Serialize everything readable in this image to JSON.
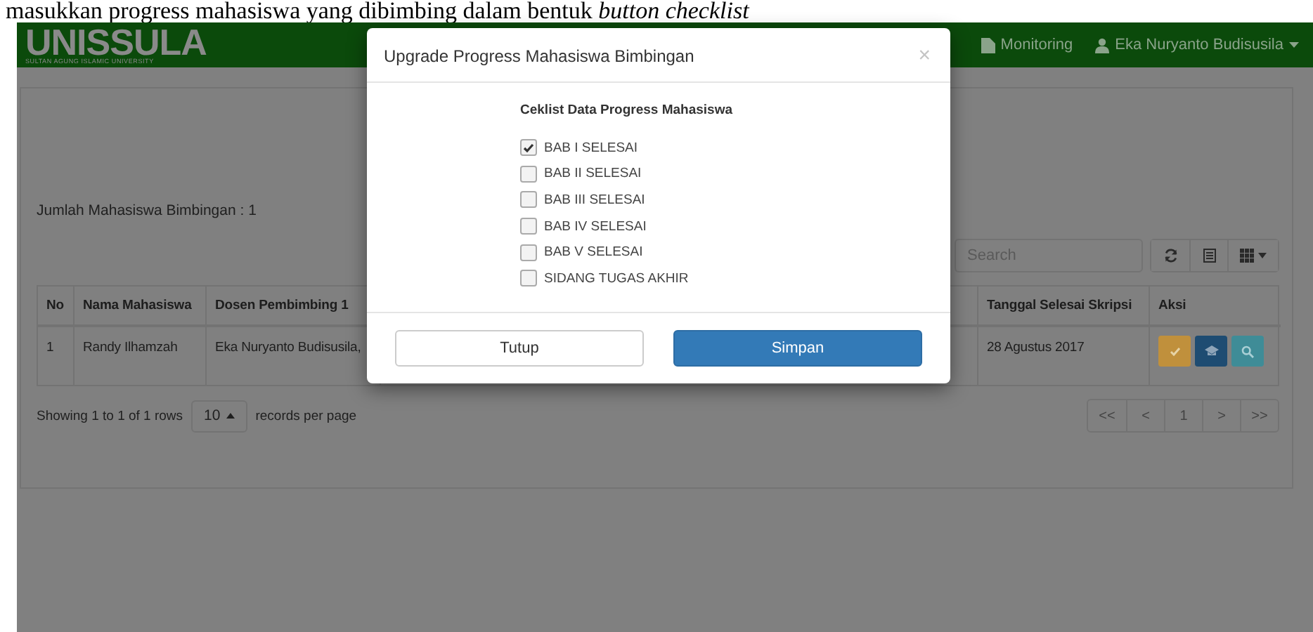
{
  "caption": "masukkan progress mahasiswa yang dibimbing dalam bentuk *button checklist*",
  "navbar": {
    "logo": "UNISSULA",
    "logo_subtitle": "SULTAN AGUNG ISLAMIC UNIVERSITY",
    "items": [
      {
        "label": "Monitoring",
        "kind": "file"
      },
      {
        "label": "Eka Nuryanto Budisusila",
        "kind": "user"
      }
    ]
  },
  "summary": "Jumlah Mahasiswa Bimbingan : 1",
  "search": {
    "placeholder": "Search"
  },
  "table": {
    "columns": [
      "No",
      "Nama Mahasiswa",
      "Dosen Pembimbing 1",
      "Tanggal Selesai Skripsi",
      "Aksi"
    ],
    "rows": [
      {
        "cells": [
          "1",
          "Randy Ilhamzah",
          "Eka Nuryanto Budisusila,",
          "28 Agustus 2017"
        ]
      }
    ]
  },
  "pagination": {
    "info": "Showing 1 to 1 of 1 rows",
    "page_size": "10",
    "suffix": "records per page",
    "pages": [
      "<<",
      "<",
      "1",
      ">",
      ">>"
    ]
  },
  "modal": {
    "title": "Upgrade Progress Mahasiswa Bimbingan",
    "close": "×",
    "heading": "Ceklist Data Progress Mahasiswa",
    "items": [
      {
        "label": "BAB I SELESAI",
        "checked": true
      },
      {
        "label": "BAB II SELESAI",
        "checked": false
      },
      {
        "label": "BAB III SELESAI",
        "checked": false
      },
      {
        "label": "BAB IV SELESAI",
        "checked": false
      },
      {
        "label": "BAB V SELESAI",
        "checked": false
      },
      {
        "label": "SIDANG TUGAS AKHIR",
        "checked": false
      }
    ],
    "buttons": [
      {
        "label": "Tutup",
        "kind": "default"
      },
      {
        "label": "Simpan",
        "kind": "primary"
      }
    ]
  }
}
